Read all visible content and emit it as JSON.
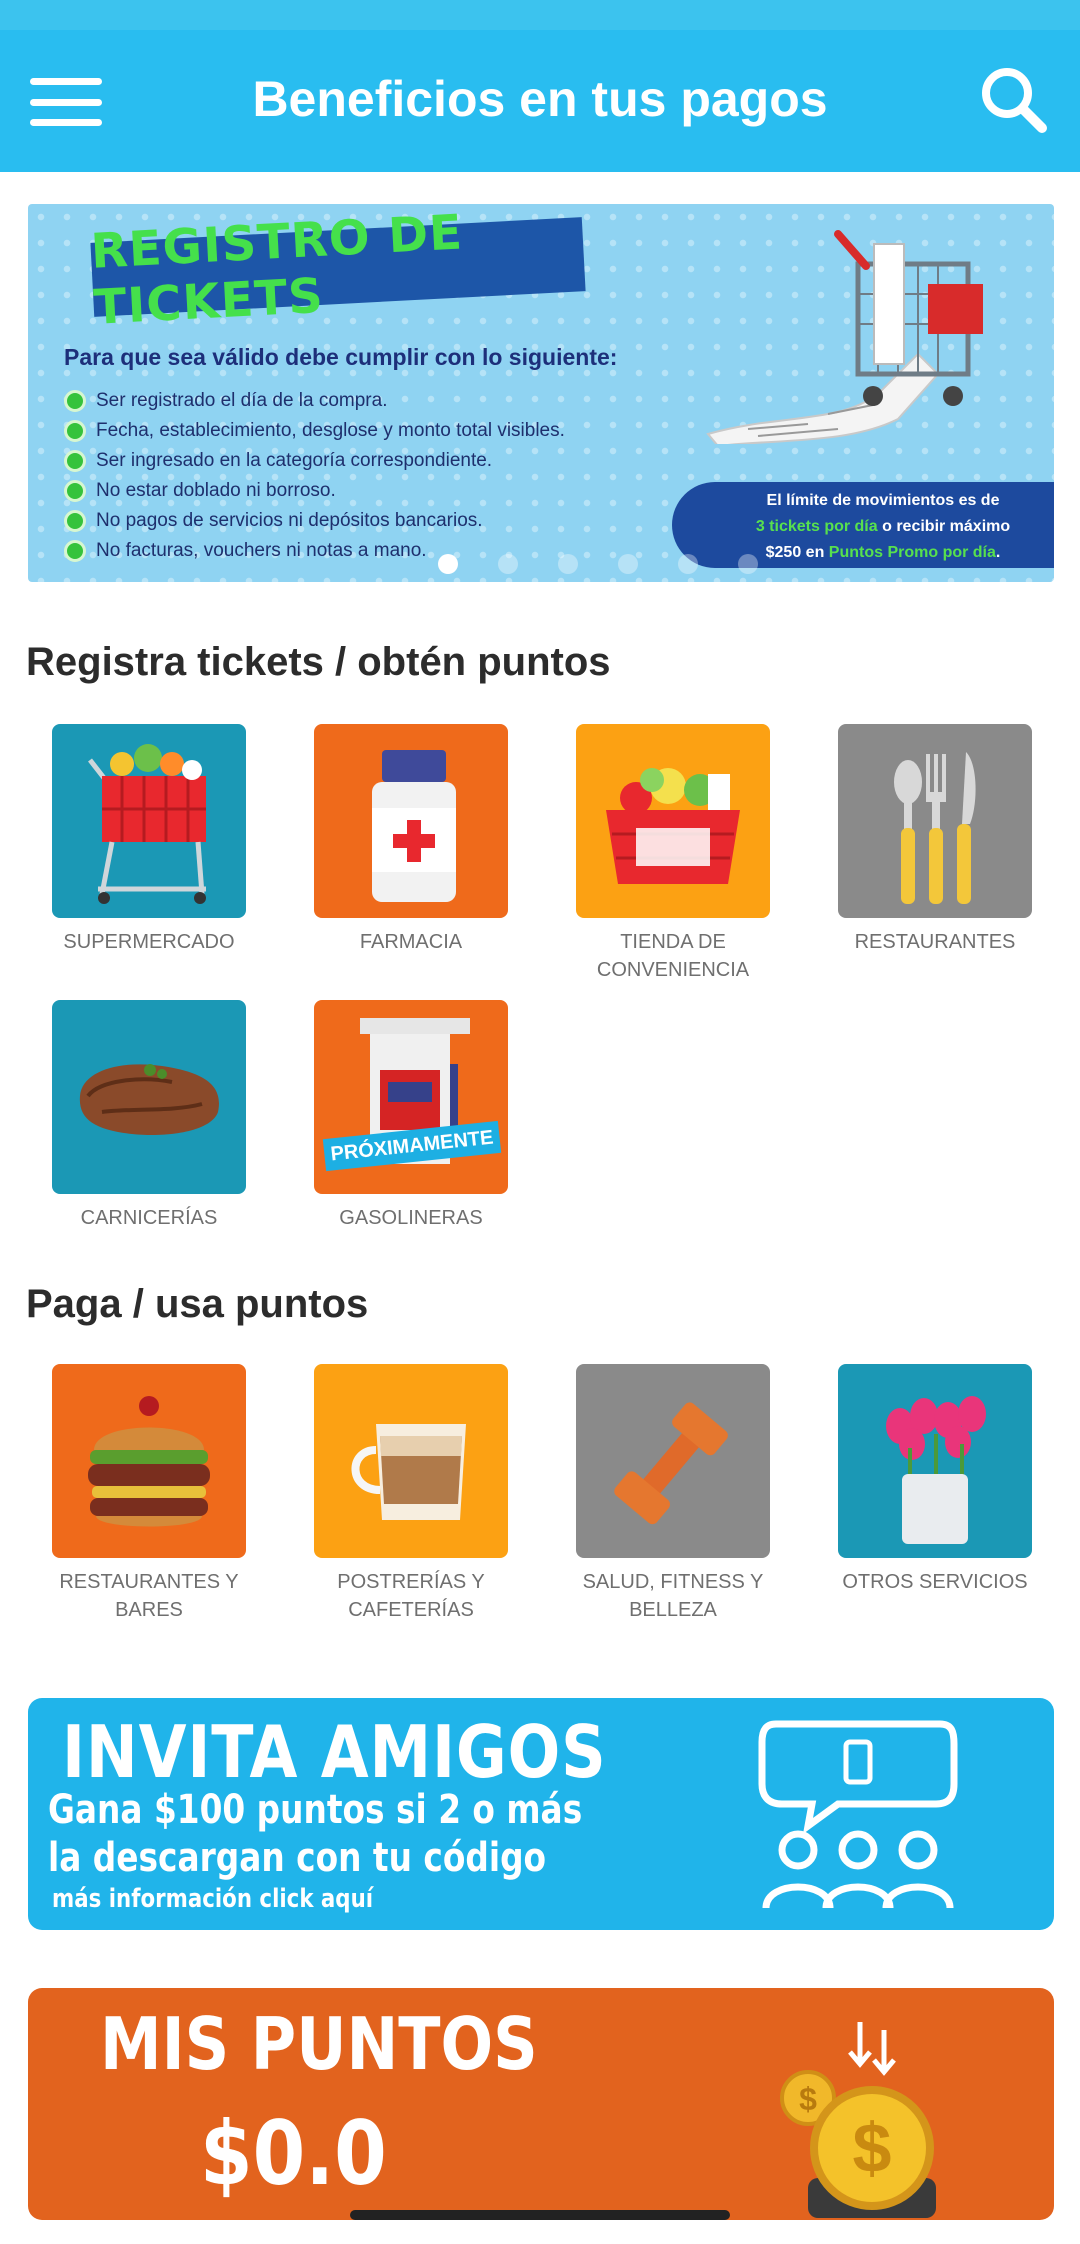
{
  "header": {
    "title": "Beneficios en tus pagos"
  },
  "banner": {
    "title": "REGISTRO DE TICKETS",
    "subtitle": "Para que sea válido debe cumplir con lo siguiente:",
    "rules": [
      "Ser registrado el día de la compra.",
      "Fecha, establecimiento, desglose y monto total visibles.",
      "Ser ingresado en la categoría correspondiente.",
      "No estar doblado ni borroso.",
      "No pagos de servicios ni depósitos bancarios.",
      "No facturas, vouchers ni notas a mano."
    ],
    "limit_line1": "El límite de movimientos es de",
    "limit_highlight1": "3 tickets por día",
    "limit_mid": " o recibir máximo",
    "limit_amount": "$250 en ",
    "limit_highlight2": "Puntos Promo por día",
    "limit_end": ".",
    "active_slide": 1,
    "slide_count": 6
  },
  "section_register": {
    "title": "Registra tickets / obtén puntos",
    "items": [
      {
        "label": "SUPERMERCADO",
        "icon": "shopping-cart-icon"
      },
      {
        "label": "FARMACIA",
        "icon": "medicine-bottle-icon"
      },
      {
        "label": "TIENDA DE CONVENIENCIA",
        "icon": "grocery-basket-icon"
      },
      {
        "label": "RESTAURANTES",
        "icon": "cutlery-icon"
      },
      {
        "label": "CARNICERÍAS",
        "icon": "steak-icon"
      },
      {
        "label": "GASOLINERAS",
        "icon": "gas-pump-icon",
        "badge": "PRÓXIMAMENTE"
      }
    ]
  },
  "section_pay": {
    "title": "Paga / usa puntos",
    "items": [
      {
        "label": "RESTAURANTES Y BARES",
        "icon": "burger-icon"
      },
      {
        "label": "POSTRERÍAS Y CAFETERÍAS",
        "icon": "coffee-cup-icon"
      },
      {
        "label": "SALUD, FITNESS Y BELLEZA",
        "icon": "dumbbell-icon"
      },
      {
        "label": "OTROS SERVICIOS",
        "icon": "flowers-icon"
      }
    ]
  },
  "invite": {
    "title": "INVITA AMIGOS",
    "line1": "Gana $100 puntos si 2 o más",
    "line2": "la descargan con tu código",
    "more": "más información click aquí"
  },
  "points": {
    "title": "MIS PUNTOS",
    "value": "$0.0"
  },
  "colors": {
    "appbar": "#29bdf0",
    "teal": "#1b98b5",
    "orange": "#ef6a1b",
    "amber": "#fca113",
    "gray": "#8a8a8a",
    "invite_bg": "#20b4ea",
    "points_bg": "#e2631e"
  }
}
